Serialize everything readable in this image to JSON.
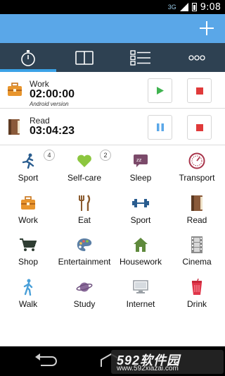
{
  "status_bar": {
    "network": "3G",
    "time": "9:08"
  },
  "action_bar": {
    "add_icon": "plus-icon"
  },
  "tabs": [
    {
      "name": "stopwatch",
      "icon": "stopwatch-icon",
      "active": true
    },
    {
      "name": "book",
      "icon": "book-icon",
      "active": false
    },
    {
      "name": "list",
      "icon": "list-icon",
      "active": false
    },
    {
      "name": "more",
      "icon": "more-icon",
      "active": false
    }
  ],
  "timers": [
    {
      "name": "Work",
      "time": "02:00:00",
      "subtitle": "Android version",
      "icon": "briefcase-icon",
      "state": "paused"
    },
    {
      "name": "Read",
      "time": "03:04:23",
      "subtitle": "",
      "icon": "book-icon",
      "state": "running"
    }
  ],
  "activities": [
    {
      "label": "Sport",
      "icon": "runner-icon",
      "badge": "4"
    },
    {
      "label": "Self-care",
      "icon": "heart-icon",
      "badge": "2"
    },
    {
      "label": "Sleep",
      "icon": "sleep-icon"
    },
    {
      "label": "Transport",
      "icon": "speedometer-icon"
    },
    {
      "label": "Work",
      "icon": "briefcase-icon"
    },
    {
      "label": "Eat",
      "icon": "fork-knife-icon"
    },
    {
      "label": "Sport",
      "icon": "dumbbell-icon"
    },
    {
      "label": "Read",
      "icon": "book-icon"
    },
    {
      "label": "Shop",
      "icon": "cart-icon"
    },
    {
      "label": "Entertainment",
      "icon": "palette-icon"
    },
    {
      "label": "Housework",
      "icon": "house-icon"
    },
    {
      "label": "Cinema",
      "icon": "film-icon"
    },
    {
      "label": "Walk",
      "icon": "walker-icon"
    },
    {
      "label": "Study",
      "icon": "planet-icon"
    },
    {
      "label": "Internet",
      "icon": "monitor-icon"
    },
    {
      "label": "Drink",
      "icon": "cup-icon"
    }
  ],
  "watermark": {
    "main": "592软件园",
    "url": "www.592xiazai.com"
  },
  "colors": {
    "action_bar": "#5aa7e8",
    "tab_bar": "#2e4152",
    "tab_indicator": "#3ba2e6",
    "play": "#3fb34f",
    "stop": "#e03a3a",
    "pause": "#5aa7e8"
  }
}
